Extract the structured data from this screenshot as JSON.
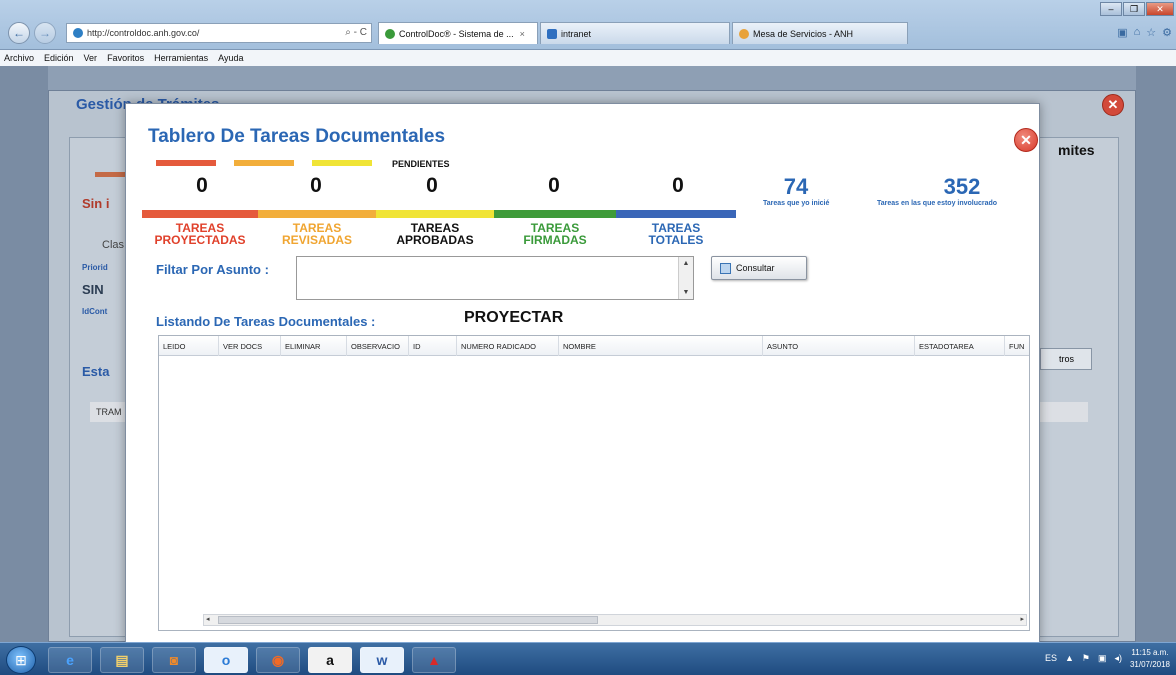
{
  "browser": {
    "url": "http://controldoc.anh.gov.co/",
    "addr_controls": "⌕ - C",
    "tabs": [
      {
        "label": "ControlDoc® - Sistema de ...",
        "close": "×"
      },
      {
        "label": "intranet"
      },
      {
        "label": "Mesa de Servicios - ANH"
      }
    ],
    "menu": [
      "Archivo",
      "Edición",
      "Ver",
      "Favoritos",
      "Herramientas",
      "Ayuda"
    ]
  },
  "background": {
    "title": "Gestión de Trámites",
    "right_heading": "mites",
    "sin_label": "Sin i",
    "clas": "Clas",
    "priori": "Priorid",
    "sin": "SIN",
    "idcont": "IdCont",
    "esta": "Esta",
    "tram": "TRAM",
    "btn": "tros"
  },
  "modal": {
    "title": "Tablero De Tareas Documentales",
    "pendientes": "PENDIENTES",
    "counters": [
      {
        "value": "0",
        "label_1": "TAREAS",
        "label_2": "PROYECTADAS",
        "color": "#e0412b",
        "bar": "#e55a3c"
      },
      {
        "value": "0",
        "label_1": "TAREAS",
        "label_2": "REVISADAS",
        "color": "#f0a531",
        "bar": "#f2ae3b"
      },
      {
        "value": "0",
        "label_1": "TAREAS",
        "label_2": "APROBADAS",
        "color": "#111111",
        "bar": "#f0e436"
      },
      {
        "value": "0",
        "label_1": "TAREAS",
        "label_2": "FIRMADAS",
        "color": "#3a9a3a",
        "bar": "#3f9b3a"
      },
      {
        "value": "0",
        "label_1": "TAREAS",
        "label_2": "TOTALES",
        "color": "#2b67b4",
        "bar": "#3a66b8"
      }
    ],
    "iniciadas": {
      "value": "74",
      "caption": "Tareas que yo inicié"
    },
    "involucrado": {
      "value": "352",
      "caption": "Tareas en las que estoy involucrado"
    },
    "filter_label": "Filtar Por Asunto :",
    "filter_value": "",
    "consultar_label": "Consultar",
    "list_label": "Listando De Tareas Documentales :",
    "mode": "PROYECTAR",
    "columns": [
      "LEIDO",
      "VER DOCS",
      "ELIMINAR",
      "OBSERVACIO",
      "ID",
      "NUMERO RADICADO",
      "NOMBRE",
      "ASUNTO",
      "ESTADOTAREA",
      "FUN"
    ]
  },
  "taskbar": {
    "apps": [
      "e",
      "▤",
      "◙",
      "o",
      "◉",
      "a",
      "w",
      "▲"
    ],
    "tray": [
      "ES",
      "▲",
      "⚑",
      "▣",
      "◂)"
    ],
    "time": "11:15 a.m.",
    "date": "31/07/2018"
  }
}
